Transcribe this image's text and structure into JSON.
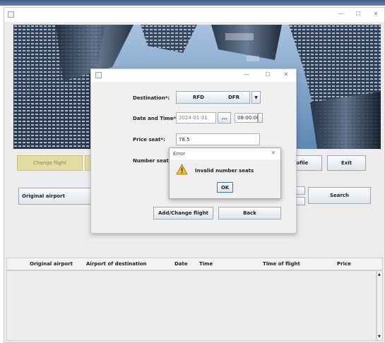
{
  "main": {
    "buttons": {
      "change_flight": "Change flight",
      "profile": "rofile",
      "exit": "Exit",
      "search": "Search"
    },
    "filter": {
      "original_airport": "Original airport"
    },
    "table": {
      "columns": [
        "Original airport",
        "Airport of destination",
        "Date",
        "Time",
        "Time of flight",
        "Price"
      ]
    }
  },
  "dialog": {
    "labels": {
      "destination": "Destination*:",
      "date_time": "Date and Time*:",
      "price": "Price seat*:",
      "seats": "Number seats*:"
    },
    "destination": {
      "code_from": "RFD",
      "code_to": "DFR"
    },
    "date_value": "2024-01-31",
    "date_button": "...",
    "time_value": "08:00:00",
    "price_value": "78.5",
    "buttons": {
      "add_change": "Add/Change flight",
      "back": "Back"
    }
  },
  "error": {
    "title": "Error",
    "message": "Invalid number seats",
    "ok": "OK"
  },
  "colors": {
    "accent_button": "#e3dca1",
    "error_icon": "#f2c12e"
  }
}
